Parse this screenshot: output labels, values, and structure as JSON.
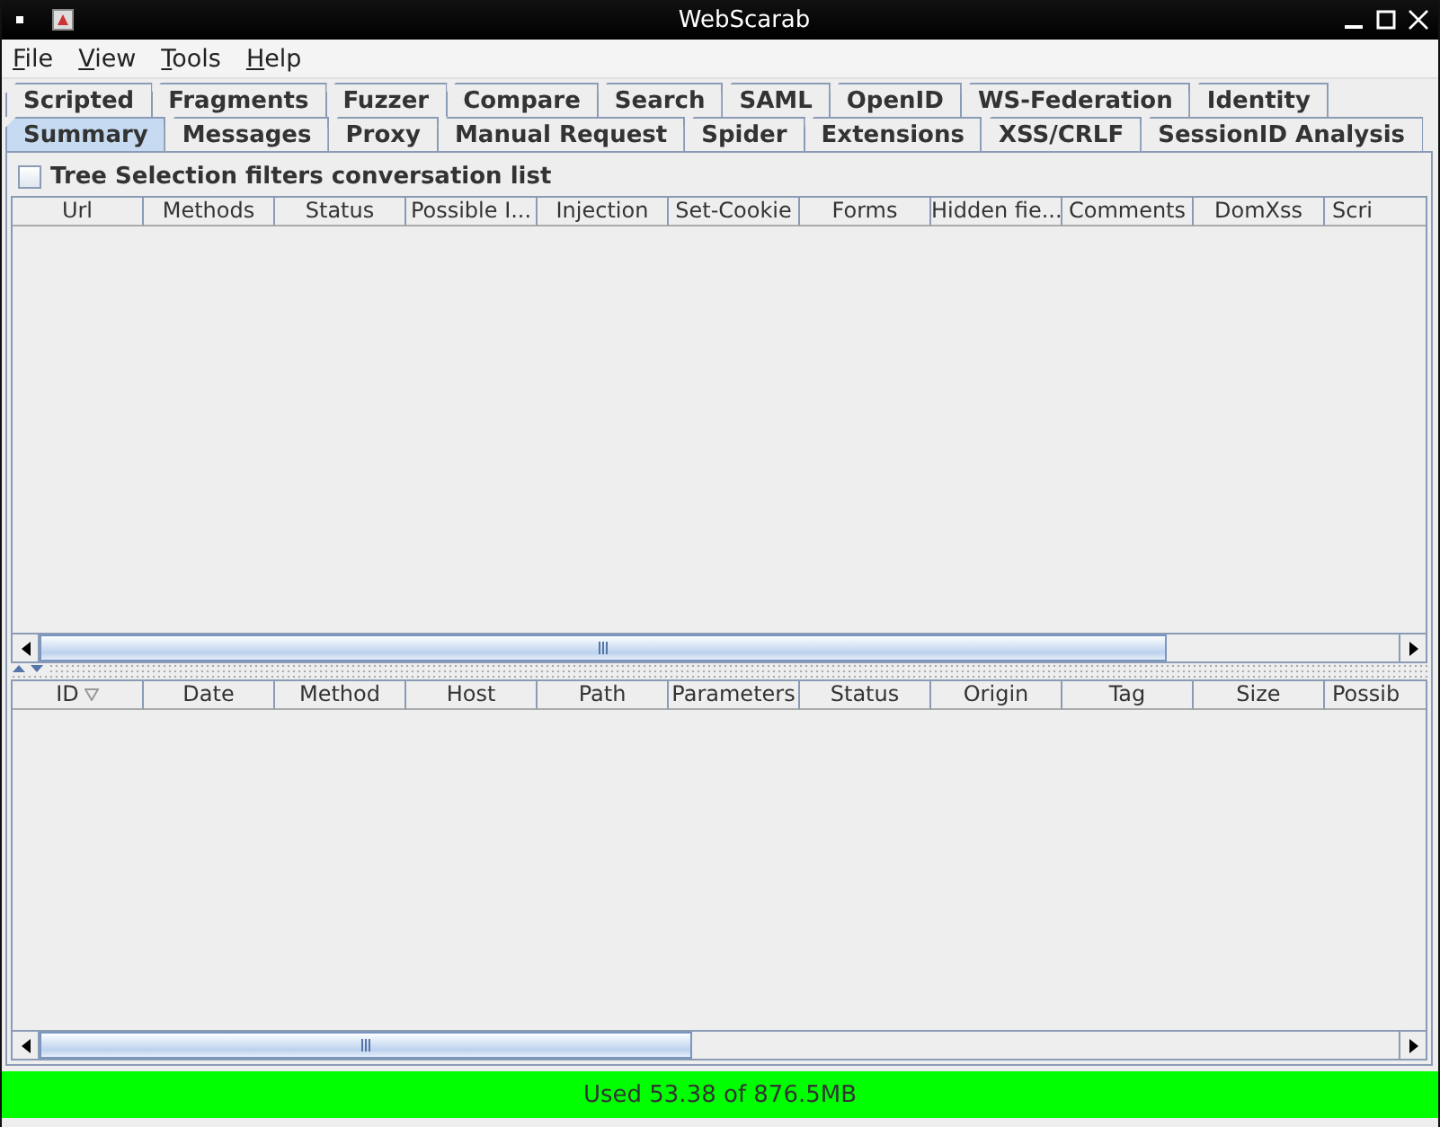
{
  "window": {
    "title": "WebScarab"
  },
  "menu": [
    "File",
    "View",
    "Tools",
    "Help"
  ],
  "tab_rows": [
    [
      {
        "label": "Scripted",
        "selected": false
      },
      {
        "label": "Fragments",
        "selected": false
      },
      {
        "label": "Fuzzer",
        "selected": false
      },
      {
        "label": "Compare",
        "selected": false
      },
      {
        "label": "Search",
        "selected": false
      },
      {
        "label": "SAML",
        "selected": false
      },
      {
        "label": "OpenID",
        "selected": false
      },
      {
        "label": "WS-Federation",
        "selected": false
      },
      {
        "label": "Identity",
        "selected": false
      }
    ],
    [
      {
        "label": "Summary",
        "selected": true
      },
      {
        "label": "Messages",
        "selected": false
      },
      {
        "label": "Proxy",
        "selected": false
      },
      {
        "label": "Manual Request",
        "selected": false
      },
      {
        "label": "Spider",
        "selected": false
      },
      {
        "label": "Extensions",
        "selected": false
      },
      {
        "label": "XSS/CRLF",
        "selected": false
      },
      {
        "label": "SessionID Analysis",
        "selected": false
      }
    ]
  ],
  "tree_filter": {
    "label": "Tree Selection filters conversation list",
    "checked": false
  },
  "url_table": {
    "columns": [
      "Url",
      "Methods",
      "Status",
      "Possible I...",
      "Injection",
      "Set-Cookie",
      "Forms",
      "Hidden fie...",
      "Comments",
      "DomXss",
      "Scri"
    ]
  },
  "conversation_table": {
    "columns": [
      "ID",
      "Date",
      "Method",
      "Host",
      "Path",
      "Parameters",
      "Status",
      "Origin",
      "Tag",
      "Size",
      "Possib"
    ]
  },
  "status_bar": {
    "text": "Used 53.38 of 876.5MB"
  }
}
